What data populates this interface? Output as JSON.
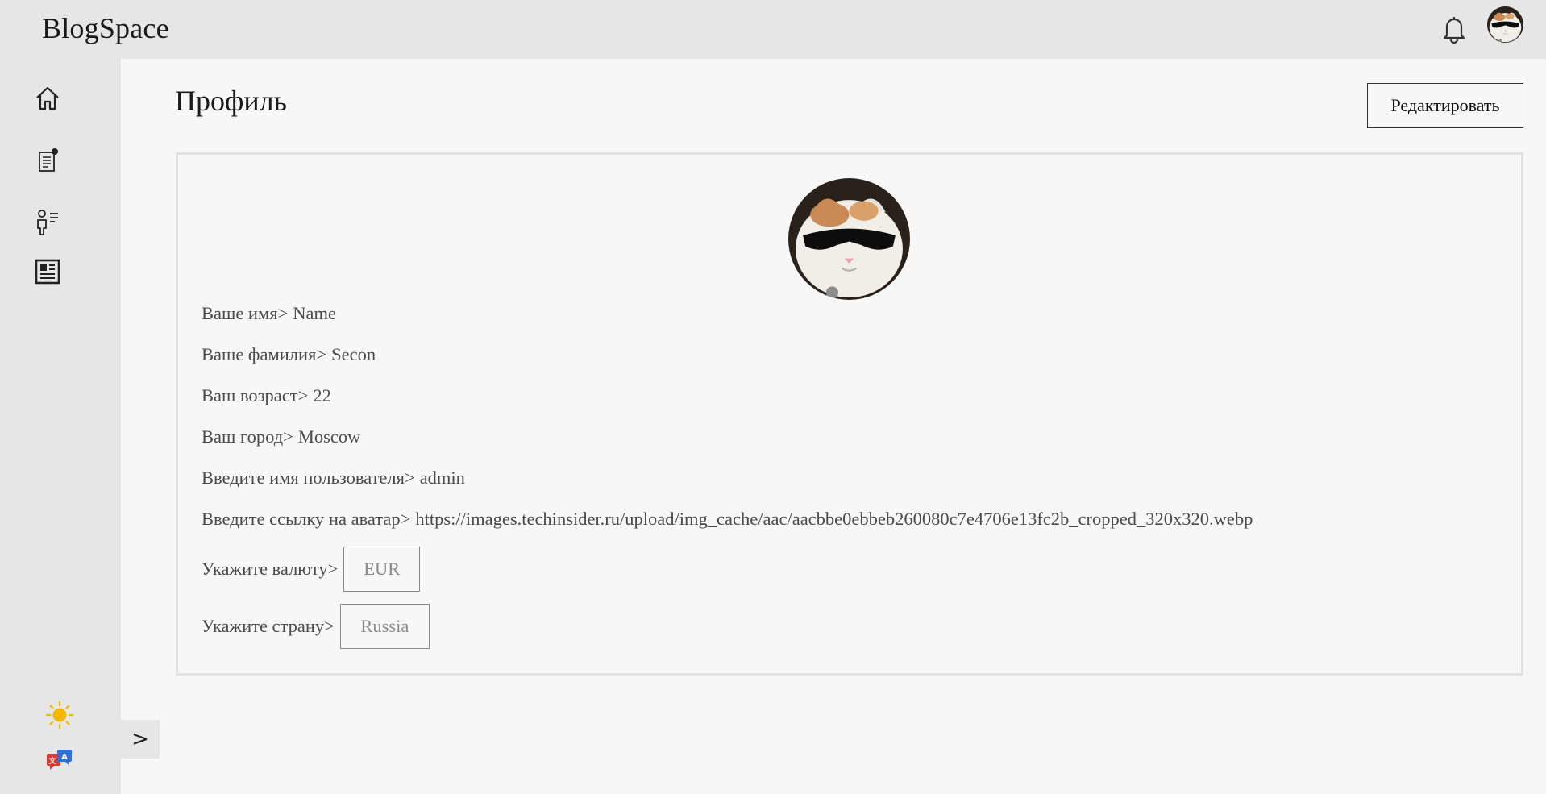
{
  "app": {
    "title": "BlogSpace"
  },
  "header": {
    "bell_icon": "bell-icon",
    "avatar": "user-avatar"
  },
  "sidebar": {
    "items": [
      {
        "icon": "home-icon"
      },
      {
        "icon": "posts-notification-icon"
      },
      {
        "icon": "users-list-icon"
      },
      {
        "icon": "article-icon"
      }
    ],
    "theme_icon": "sun-icon",
    "language_icon": "translate-icon",
    "collapse_label": ">"
  },
  "page": {
    "title": "Профиль",
    "edit_button": "Редактировать"
  },
  "profile": {
    "fields": [
      {
        "label": "Ваше имя>",
        "value": "Name"
      },
      {
        "label": "Ваше фамилия>",
        "value": "Secon"
      },
      {
        "label": "Ваш возраст>",
        "value": "22"
      },
      {
        "label": "Ваш город>",
        "value": "Moscow"
      },
      {
        "label": "Введите имя пользователя>",
        "value": "admin"
      },
      {
        "label": "Введите ссылку на аватар>",
        "value": "https://images.techinsider.ru/upload/img_cache/aac/aacbbe0ebbeb260080c7e4706e13fc2b_cropped_320x320.webp"
      }
    ],
    "currency": {
      "label": "Укажите валюту>",
      "value": "EUR"
    },
    "country": {
      "label": "Укажите страну>",
      "value": "Russia"
    }
  },
  "colors": {
    "background": "#f7f7f7",
    "chrome": "#e6e6e6",
    "text": "#4a4a4a",
    "accent_sun": "#f5b800"
  }
}
